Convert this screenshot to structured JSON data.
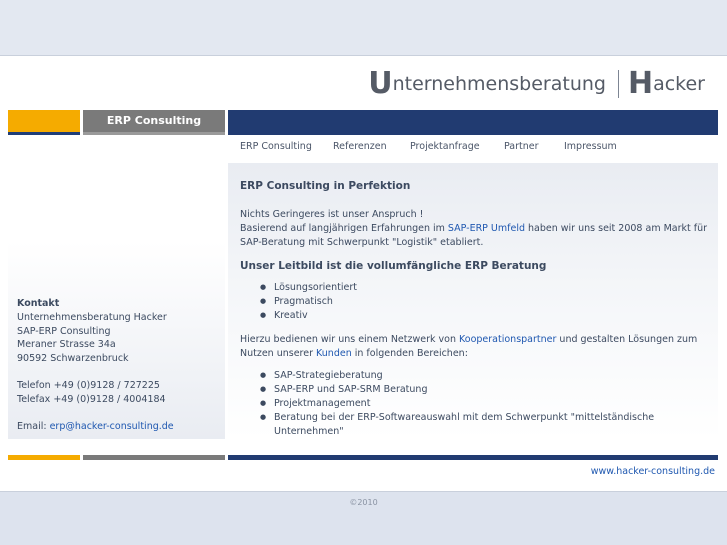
{
  "logo": {
    "u": "U",
    "text1": "nternehmensberatung",
    "h": "H",
    "text2": "acker"
  },
  "header": {
    "section_label": "ERP Consulting"
  },
  "nav": [
    {
      "label": "ERP Consulting"
    },
    {
      "label": "Referenzen"
    },
    {
      "label": "Projektanfrage"
    },
    {
      "label": "Partner"
    },
    {
      "label": "Impressum"
    }
  ],
  "contact": {
    "heading": "Kontakt",
    "lines": [
      "Unternehmensberatung Hacker",
      "SAP-ERP Consulting",
      "Meraner Strasse 34a",
      "90592 Schwarzenbruck"
    ],
    "phone": "Telefon +49 (0)9128 / 727225",
    "fax": "Telefax +49 (0)9128 / 4004184",
    "email_label": "Email: ",
    "email": "erp@hacker-consulting.de"
  },
  "content": {
    "title": "ERP Consulting in Perfektion",
    "p1_line1": "Nichts Geringeres ist unser Anspruch !",
    "p1_pre": "Basierend auf langjährigen Erfahrungen im ",
    "p1_link": "SAP-ERP Umfeld",
    "p1_post": " haben wir uns seit 2008 am Markt für SAP-Beratung mit Schwerpunkt \"Logistik\" etabliert.",
    "subtitle": "Unser Leitbild ist die vollumfängliche ERP Beratung",
    "list1": [
      "Lösungsorientiert",
      "Pragmatisch",
      "Kreativ"
    ],
    "p2_pre": "Hierzu bedienen wir uns einem Netzwerk von ",
    "p2_link1": "Kooperationspartner",
    "p2_mid": " und gestalten Lösungen zum Nutzen unserer ",
    "p2_link2": "Kunden",
    "p2_post": " in folgenden Bereichen:",
    "list2": [
      "SAP-Strategieberatung",
      "SAP-ERP und SAP-SRM Beratung",
      "Projektmanagement",
      "Beratung bei der ERP-Softwareauswahl mit dem Schwerpunkt \"mittelständische Unternehmen\""
    ]
  },
  "footer": {
    "website": "www.hacker-consulting.de",
    "copyright": "©2010"
  }
}
